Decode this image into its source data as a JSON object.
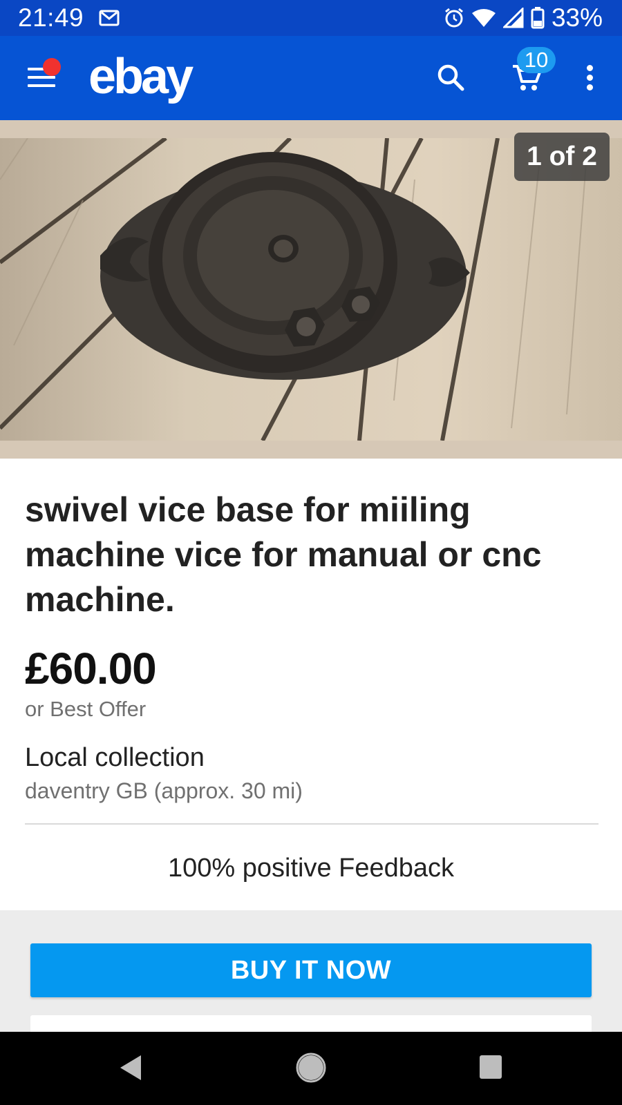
{
  "status_bar": {
    "time": "21:49",
    "battery": "33%",
    "icons": [
      "mail-icon",
      "alarm-icon",
      "wifi-icon",
      "signal-icon",
      "battery-icon"
    ]
  },
  "app_bar": {
    "logo": "ebay",
    "cart_count": "10",
    "icons": [
      "menu-icon",
      "search-icon",
      "cart-icon",
      "more-icon"
    ],
    "colors": {
      "bar": "#0654d4",
      "status": "#0a47c4",
      "notify_dot": "#f0322f",
      "badge": "#1d9bf0"
    }
  },
  "gallery": {
    "counter": "1 of 2"
  },
  "listing": {
    "title": "swivel vice base for miiling machine vice for manual or cnc machine.",
    "price": "£60.00",
    "best_offer": "or Best Offer",
    "shipping": "Local collection",
    "location": "daventry GB (approx. 30 mi)",
    "feedback": "100% positive Feedback"
  },
  "actions": {
    "buy_now": "BUY IT NOW",
    "colors": {
      "buy_button": "#0598f0"
    }
  },
  "nav_bar": {
    "icons": [
      "back-icon",
      "home-icon",
      "recents-icon"
    ]
  }
}
